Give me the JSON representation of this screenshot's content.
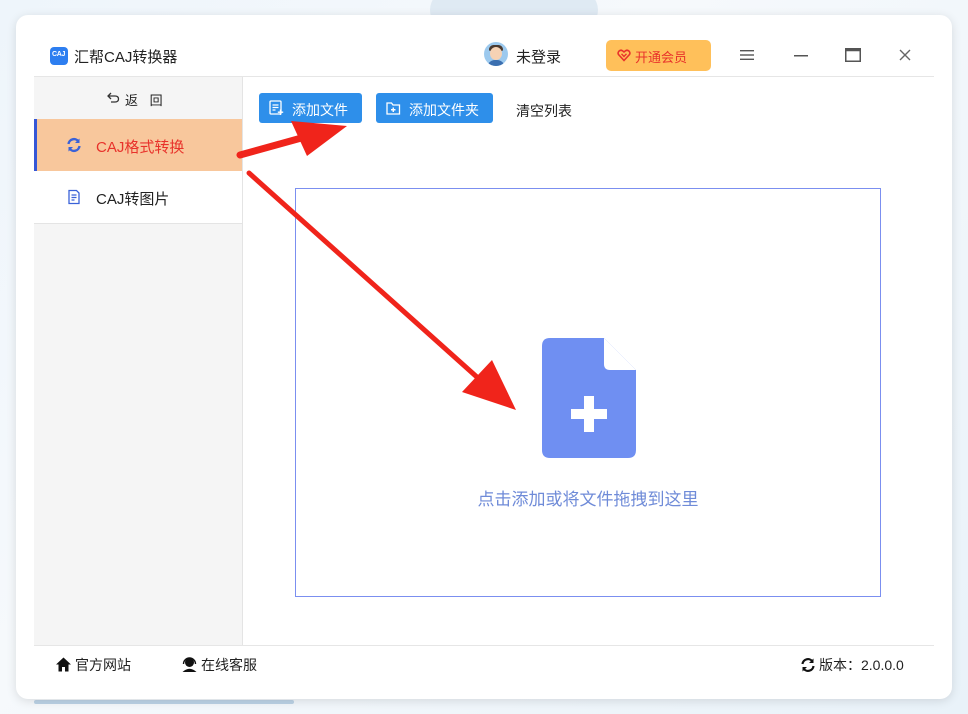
{
  "app": {
    "title": "汇帮CAJ转换器",
    "logo_text": "CAJ"
  },
  "header": {
    "login_status": "未登录",
    "vip_label": "开通会员",
    "menu_icon": "hamburger-icon",
    "minimize_icon": "minimize-icon",
    "maximize_icon": "maximize-icon",
    "close_icon": "close-icon"
  },
  "sidebar": {
    "back_label": "返 回",
    "items": [
      {
        "label": "CAJ格式转换",
        "icon": "refresh-icon",
        "active": true
      },
      {
        "label": "CAJ转图片",
        "icon": "document-icon",
        "active": false
      }
    ]
  },
  "toolbar": {
    "add_file_label": "添加文件",
    "add_folder_label": "添加文件夹",
    "clear_label": "清空列表"
  },
  "dropzone": {
    "hint": "点击添加或将文件拖拽到这里",
    "icon": "file-add-icon"
  },
  "footer": {
    "website_label": "官方网站",
    "support_label": "在线客服",
    "version_label": "版本：2.0.0.0"
  },
  "colors": {
    "accent": "#2e8fea",
    "active_nav_bg": "#f8c79c",
    "active_nav_text": "#e8322b",
    "vip_bg": "#ffc05a",
    "dropzone_border": "#7b8ff0",
    "doc_icon": "#6f8ff2",
    "annotation_arrow": "#f0241b"
  }
}
